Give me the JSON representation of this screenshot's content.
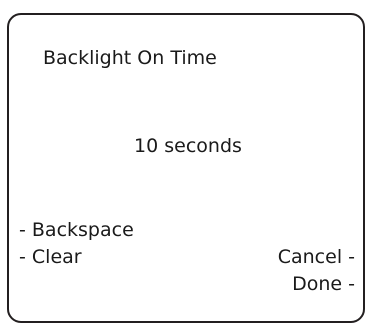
{
  "screen": {
    "title": "Backlight On Time",
    "value": "10 seconds"
  },
  "softkeys": {
    "left": [
      "- Backspace",
      "- Clear"
    ],
    "right": [
      "Cancel -",
      "Done -"
    ]
  }
}
